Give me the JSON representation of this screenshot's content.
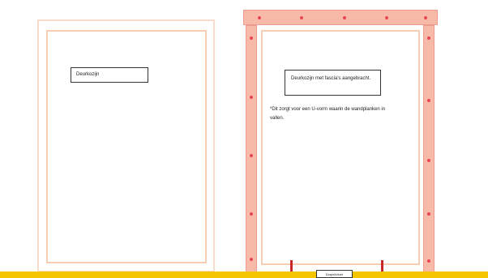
{
  "left_frame": {
    "label": "Deurkozijn"
  },
  "right_frame": {
    "label": "Deurkozijn met fascia's aangebracht.",
    "note": "*Dit zorgt voor een U-vorm waarin de wandplanken in vallen."
  },
  "floor": {
    "tag": "Dorpel/vloer"
  },
  "colors": {
    "frame_fill": "#f7b9a8",
    "frame_line": "#f6cfb3",
    "marker": "#e8474f",
    "peg": "#c62828",
    "floor": "#f5c400"
  }
}
